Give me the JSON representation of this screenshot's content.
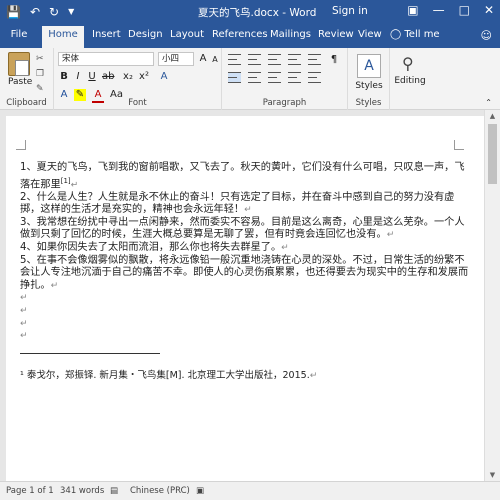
{
  "window": {
    "title": "夏天的飞鸟.docx - Word",
    "sign_in": "Sign in"
  },
  "quick_access": {
    "save_icon": "save-icon",
    "undo_icon": "undo-icon",
    "redo_icon": "redo-icon"
  },
  "tabs": {
    "file": "File",
    "home": "Home",
    "insert": "Insert",
    "design": "Design",
    "layout": "Layout",
    "references": "References",
    "mailings": "Mailings",
    "review": "Review",
    "view": "View",
    "tell_me": "Tell me"
  },
  "ribbon": {
    "clipboard": {
      "label": "Clipboard",
      "paste": "Paste"
    },
    "font": {
      "label": "Font",
      "font_name": "宋体",
      "font_size": "小四",
      "bold": "B",
      "italic": "I",
      "underline": "U"
    },
    "paragraph": {
      "label": "Paragraph"
    },
    "styles": {
      "label": "Styles"
    },
    "editing": {
      "label": "Editing"
    }
  },
  "document": {
    "paragraphs": [
      "1、夏天的飞鸟，飞到我的窗前唱歌，又飞去了。秋天的黄叶，它们没有什么可唱，只叹息一声，飞落在那里",
      "2、什么是人生？人生就是永不休止的奋斗！只有选定了目标，并在奋斗中感到自己的努力没有虚掷，这样的生活才是充实的，精神也会永远年轻！",
      "3、我常想在纷扰中寻出一点闲静来，然而委实不容易。目前是这么离奇，心里是这么芜杂。一个人做到只剩了回忆的时候，生涯大概总要算是无聊了罢，但有时竟会连回忆也没有。",
      "4、如果你因失去了太阳而流泪，那么你也将失去群星了。",
      "5、在事不会像烟雾似的飘散，将永远像铅一般沉重地浇铸在心灵的深处。不过，日常生活的纷繁不会让人专注地沉湎于自己的痛苦不幸。即使人的心灵伤痕累累，也还得要去为现实中的生存和发展而挣扎。"
    ],
    "footnote_ref": "[1]",
    "footnote": "¹ 泰戈尔，郑振铎. 新月集・飞鸟集[M]. 北京理工大学出版社，2015."
  },
  "status": {
    "page": "Page 1 of 1",
    "words": "341 words",
    "language": "Chinese (PRC)"
  }
}
